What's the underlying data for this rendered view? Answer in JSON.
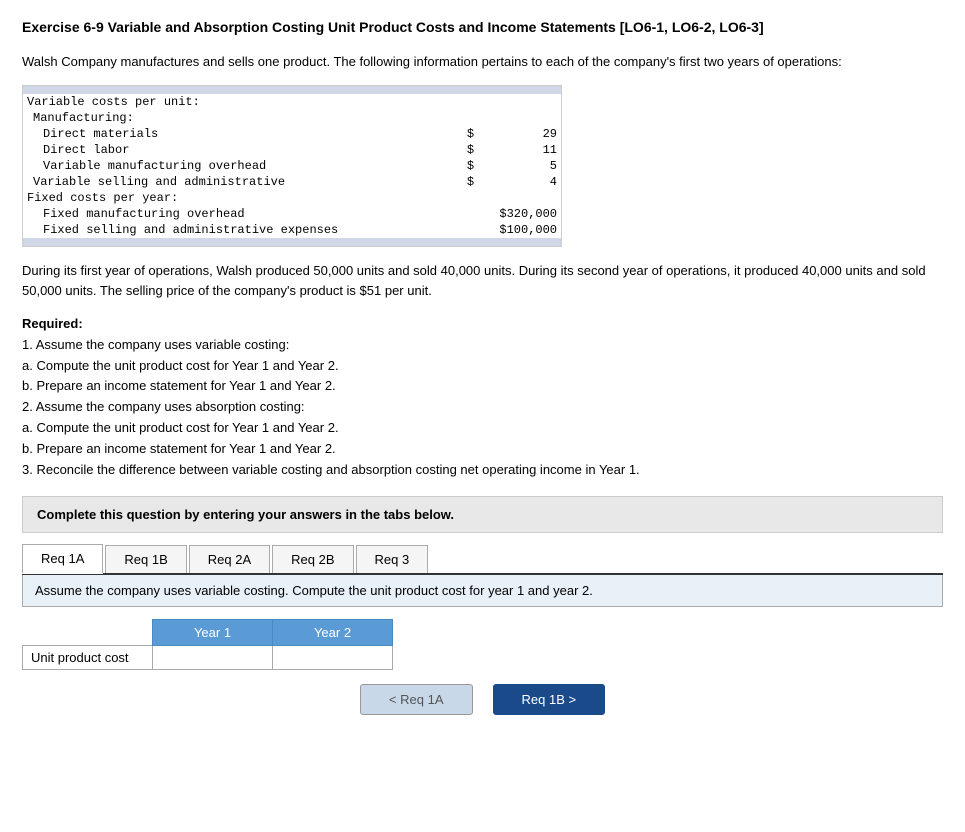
{
  "page": {
    "title": "Exercise 6-9 Variable and Absorption Costing Unit Product Costs and Income Statements [LO6-1, LO6-2, LO6-3]",
    "intro": "Walsh Company manufactures and sells one product. The following information pertains to each of the company's first two years of operations:",
    "cost_table": {
      "header_row": "Variable costs per unit:",
      "rows": [
        {
          "label": "Manufacturing:",
          "indent": 1,
          "symbol": "",
          "value": ""
        },
        {
          "label": "Direct materials",
          "indent": 2,
          "symbol": "$",
          "value": "29"
        },
        {
          "label": "Direct labor",
          "indent": 2,
          "symbol": "$",
          "value": "11"
        },
        {
          "label": "Variable manufacturing overhead",
          "indent": 2,
          "symbol": "$",
          "value": "5"
        },
        {
          "label": "Variable selling and administrative",
          "indent": 1,
          "symbol": "$",
          "value": "4"
        },
        {
          "label": "Fixed costs per year:",
          "indent": 0,
          "symbol": "",
          "value": ""
        },
        {
          "label": "Fixed manufacturing overhead",
          "indent": 2,
          "symbol": "",
          "value": "$320,000"
        },
        {
          "label": "Fixed selling and administrative expenses",
          "indent": 2,
          "symbol": "",
          "value": "$100,000"
        }
      ]
    },
    "description": "During its first year of operations, Walsh produced 50,000 units and sold 40,000 units. During its second year of operations, it produced 40,000 units and sold 50,000 units. The selling price of the company's product is $51 per unit.",
    "required_title": "Required:",
    "required_items": [
      "1. Assume the company uses variable costing:",
      "a. Compute the unit product cost for Year 1 and Year 2.",
      "b. Prepare an income statement for Year 1 and Year 2.",
      "2. Assume the company uses absorption costing:",
      "a. Compute the unit product cost for Year 1 and Year 2.",
      "b. Prepare an income statement for Year 1 and Year 2.",
      "3. Reconcile the difference between variable costing and absorption costing net operating income in Year 1."
    ],
    "complete_instruction": "Complete this question by entering your answers in the tabs below.",
    "tabs": [
      {
        "id": "req1a",
        "label": "Req 1A",
        "active": true
      },
      {
        "id": "req1b",
        "label": "Req 1B",
        "active": false
      },
      {
        "id": "req2a",
        "label": "Req 2A",
        "active": false
      },
      {
        "id": "req2b",
        "label": "Req 2B",
        "active": false
      },
      {
        "id": "req3",
        "label": "Req 3",
        "active": false
      }
    ],
    "tab_content": "Assume the company uses variable costing. Compute the unit product cost for year 1 and year 2.",
    "answer_table": {
      "col1_header": "Year 1",
      "col2_header": "Year 2",
      "row_label": "Unit product cost",
      "year1_value": "",
      "year2_value": ""
    },
    "nav": {
      "prev_label": "< Req 1A",
      "next_label": "Req 1B >"
    },
    "year_label": "Year"
  }
}
